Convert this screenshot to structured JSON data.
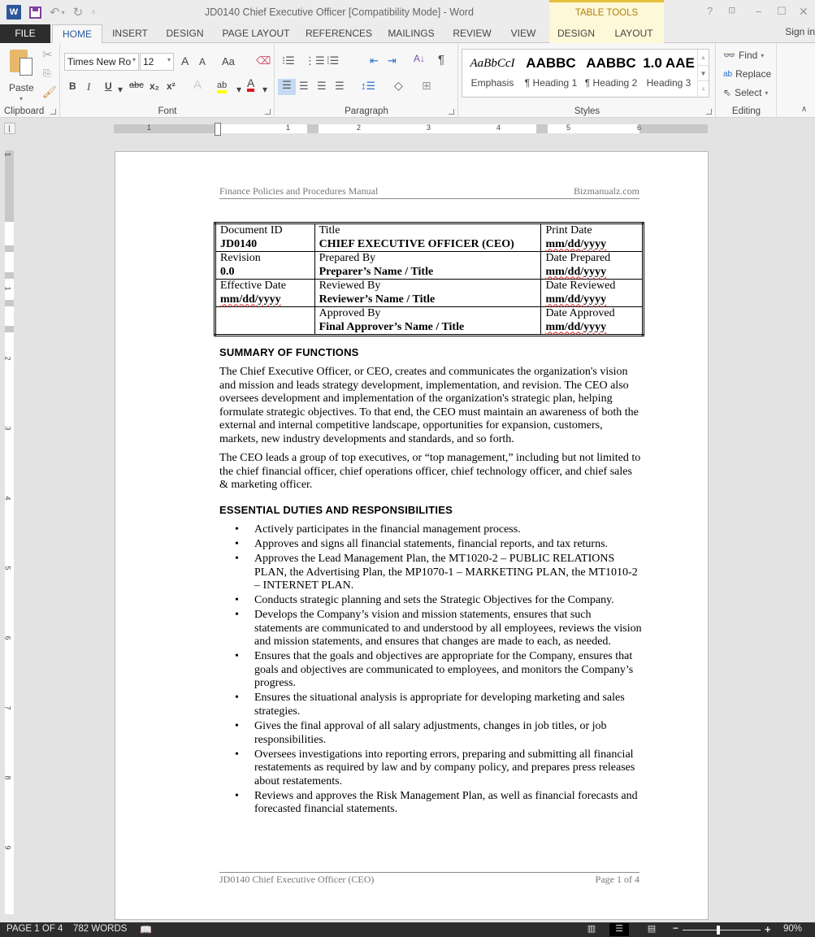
{
  "window": {
    "title": "JD0140 Chief Executive Officer [Compatibility Mode] - Word",
    "contextual_group": "TABLE TOOLS",
    "controls": [
      "?",
      "restore-ribbon",
      "minimize",
      "maximize",
      "close"
    ],
    "sign_in": "Sign in"
  },
  "qat": {
    "undo": "↶",
    "redo": "↻",
    "customize": "⌄"
  },
  "tabs": [
    {
      "label": "FILE"
    },
    {
      "label": "HOME"
    },
    {
      "label": "INSERT"
    },
    {
      "label": "DESIGN"
    },
    {
      "label": "PAGE LAYOUT"
    },
    {
      "label": "REFERENCES"
    },
    {
      "label": "MAILINGS"
    },
    {
      "label": "REVIEW"
    },
    {
      "label": "VIEW"
    },
    {
      "label": "DESIGN"
    },
    {
      "label": "LAYOUT"
    }
  ],
  "ribbon": {
    "clipboard": {
      "label": "Clipboard",
      "paste": "Paste"
    },
    "font": {
      "label": "Font",
      "font_name": "Times New Ro",
      "font_size": "12",
      "grow": "A",
      "shrink": "A",
      "change_case": "Aa",
      "bold": "B",
      "italic": "I",
      "underline": "U",
      "strike": "abc",
      "sub": "x₂",
      "sup": "x²",
      "text_effects": "A",
      "highlight": "ab",
      "font_color": "A",
      "highlight_color": "#ffff00",
      "font_color_value": "#e81123"
    },
    "paragraph": {
      "label": "Paragraph",
      "pilcrow": "¶"
    },
    "styles": {
      "label": "Styles",
      "items": [
        {
          "preview": "AaBbCcI",
          "name": "Emphasis"
        },
        {
          "preview": "AABBC",
          "name": "¶ Heading 1"
        },
        {
          "preview": "AABBC",
          "name": "¶ Heading 2"
        },
        {
          "preview": "1.0  AAE",
          "name": "Heading 3"
        }
      ]
    },
    "editing": {
      "label": "Editing",
      "find": "Find",
      "replace": "Replace",
      "select": "Select"
    }
  },
  "ruler": {
    "h_numbers": [
      "1",
      "1",
      "2",
      "3",
      "4",
      "5",
      "6"
    ],
    "v_numbers": [
      "1",
      "1",
      "2",
      "3",
      "4",
      "5",
      "6",
      "7",
      "8",
      "9"
    ]
  },
  "document": {
    "header_left": "Finance Policies and Procedures Manual",
    "header_right": "Bizmanualz.com",
    "table": [
      [
        {
          "label": "Document ID",
          "value": "JD0140"
        },
        {
          "label": "Title",
          "value": "CHIEF EXECUTIVE OFFICER (CEO)"
        },
        {
          "label": "Print Date",
          "value": "mm/dd/yyyy"
        }
      ],
      [
        {
          "label": "Revision",
          "value": "0.0"
        },
        {
          "label": "Prepared By",
          "value": "Preparer’s Name / Title"
        },
        {
          "label": "Date Prepared",
          "value": "mm/dd/yyyy"
        }
      ],
      [
        {
          "label": "Effective Date",
          "value": "mm/dd/yyyy"
        },
        {
          "label": "Reviewed By",
          "value": "Reviewer’s Name / Title"
        },
        {
          "label": "Date Reviewed",
          "value": "mm/dd/yyyy"
        }
      ],
      [
        {
          "label": "",
          "value": ""
        },
        {
          "label": "Approved By",
          "value": "Final Approver’s Name / Title"
        },
        {
          "label": "Date Approved",
          "value": "mm/dd/yyyy"
        }
      ]
    ],
    "summary_heading": "SUMMARY OF FUNCTIONS",
    "summary_p1": "The Chief Executive Officer, or CEO, creates and communicates the organization's vision and mission and leads strategy development, implementation, and revision. The CEO also oversees development and implementation of the organization's strategic plan, helping formulate strategic objectives. To that end, the CEO must maintain an awareness of both the external and internal competitive landscape, opportunities for expansion, customers, markets, new industry developments and standards, and so forth.",
    "summary_p2": "The CEO leads a group of top executives, or “top management,” including but not limited to the chief financial officer, chief operations officer, chief technology officer, and chief sales & marketing officer.",
    "duties_heading": "ESSENTIAL DUTIES AND RESPONSIBILITIES",
    "duties": [
      "Actively participates in the financial management process.",
      "Approves and signs all financial statements, financial reports, and tax returns.",
      "Approves the Lead Management Plan, the MT1020-2 – PUBLIC RELATIONS PLAN, the Advertising Plan, the MP1070-1 – MARKETING PLAN, the MT1010-2 – INTERNET PLAN.",
      "Conducts strategic planning and sets the Strategic Objectives for the Company.",
      "Develops the Company’s vision and mission statements, ensures that such statements are communicated to and understood by all employees, reviews the vision and mission statements, and ensures that changes are made to each, as needed.",
      "Ensures that the goals and objectives are appropriate for the Company, ensures that goals and objectives are communicated to employees, and monitors the Company’s progress.",
      "Ensures the situational analysis is appropriate for developing marketing and sales strategies.",
      "Gives the final approval of all salary adjustments, changes in job titles, or job responsibilities.",
      "Oversees investigations into reporting errors, preparing and submitting all financial restatements as required by law and by company policy, and prepares press releases about restatements.",
      "Reviews and approves the Risk Management Plan, as well as financial forecasts and forecasted financial statements."
    ],
    "footer_left": "JD0140 Chief Executive Officer (CEO)",
    "footer_right": "Page 1 of 4"
  },
  "status": {
    "page": "PAGE 1 OF 4",
    "words": "782 WORDS",
    "zoom": "90%",
    "zoom_minus": "−",
    "zoom_plus": "+"
  }
}
